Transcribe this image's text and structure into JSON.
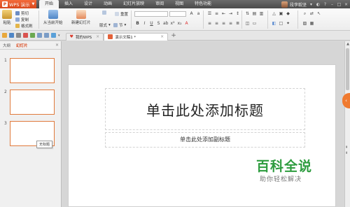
{
  "app": {
    "name": "WPS 演示",
    "logo_letter": "P"
  },
  "ribbon_tabs": [
    "开始",
    "插入",
    "设计",
    "动画",
    "幻灯片放映",
    "审阅",
    "视图",
    "特色功能"
  ],
  "active_tab": "开始",
  "user": {
    "name": "段李毅坚"
  },
  "ribbon": {
    "paste": "粘贴",
    "cut": "剪切",
    "copy": "复制",
    "format_painter": "格式刷",
    "from_current": "从当前开始",
    "new_slide": "新建幻灯片",
    "layout": "版式",
    "section": "节",
    "reset": "重置"
  },
  "doc_tabs": [
    {
      "label": "我的WPS",
      "active": false
    },
    {
      "label": "演示文稿1 *",
      "active": true
    }
  ],
  "left_panel": {
    "tabs": [
      "大纲",
      "幻灯片"
    ],
    "active_tab": "幻灯片",
    "slide_numbers": [
      "1",
      "2",
      "3"
    ],
    "tooltip": "无标题"
  },
  "slide": {
    "title_placeholder": "单击此处添加标题",
    "subtitle_placeholder": "单击此处添加副标题"
  },
  "watermark": {
    "title": "百科全说",
    "subtitle": "助你轻松解决"
  },
  "colors": {
    "accent": "#d9481c",
    "thumb_border": "#e07a3c",
    "watermark_green": "#2e9c3f"
  }
}
